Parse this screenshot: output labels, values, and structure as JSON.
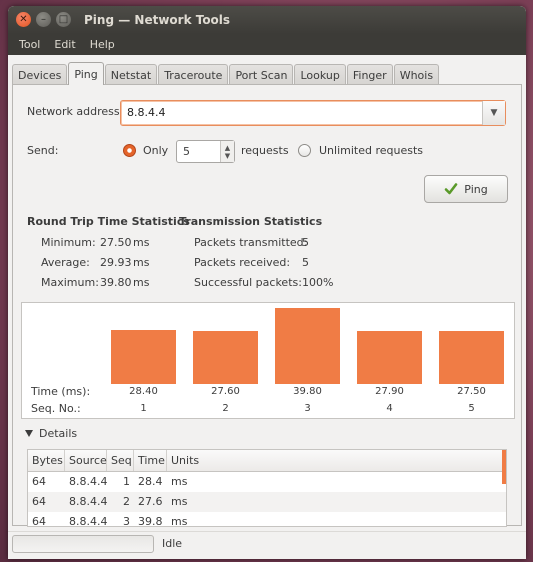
{
  "window": {
    "title": "Ping — Network Tools"
  },
  "menu": [
    "Tool",
    "Edit",
    "Help"
  ],
  "tabs": [
    "Devices",
    "Ping",
    "Netstat",
    "Traceroute",
    "Port Scan",
    "Lookup",
    "Finger",
    "Whois"
  ],
  "active_tab": "Ping",
  "form": {
    "address_label": "Network address:",
    "address_value": "8.8.4.4",
    "send_label": "Send:",
    "only_label": "Only",
    "count_value": "5",
    "requests_label": "requests",
    "unlimited_label": "Unlimited requests",
    "send_mode": "only",
    "ping_button": "Ping"
  },
  "rtt": {
    "title": "Round Trip Time Statistics",
    "minimum_label": "Minimum:",
    "minimum_value": "27.50",
    "minimum_unit": "ms",
    "average_label": "Average:",
    "average_value": "29.93",
    "average_unit": "ms",
    "maximum_label": "Maximum:",
    "maximum_value": "39.80",
    "maximum_unit": "ms"
  },
  "transmission": {
    "title": "Transmission Statistics",
    "transmitted_label": "Packets transmitted:",
    "transmitted_value": "5",
    "received_label": "Packets received:",
    "received_value": "5",
    "success_label": "Successful packets:",
    "success_value": "100%"
  },
  "chart_data": {
    "type": "bar",
    "categories": [
      "1",
      "2",
      "3",
      "4",
      "5"
    ],
    "values": [
      28.4,
      27.6,
      39.8,
      27.9,
      27.5
    ],
    "value_labels": [
      "28.40",
      "27.60",
      "39.80",
      "27.90",
      "27.50"
    ],
    "xlabel": "Seq. No.:",
    "ylabel": "Time (ms):",
    "color": "#f07c45"
  },
  "details": {
    "label": "Details",
    "columns": [
      "Bytes",
      "Source",
      "Seq",
      "Time",
      "Units"
    ],
    "rows": [
      [
        "64",
        "8.8.4.4",
        "1",
        "28.4",
        "ms"
      ],
      [
        "64",
        "8.8.4.4",
        "2",
        "27.6",
        "ms"
      ],
      [
        "64",
        "8.8.4.4",
        "3",
        "39.8",
        "ms"
      ]
    ]
  },
  "status": {
    "text": "Idle"
  },
  "colors": {
    "accent": "#f07c45",
    "titlebar": "#3c3b37",
    "window_bg": "#f2f1f0"
  }
}
